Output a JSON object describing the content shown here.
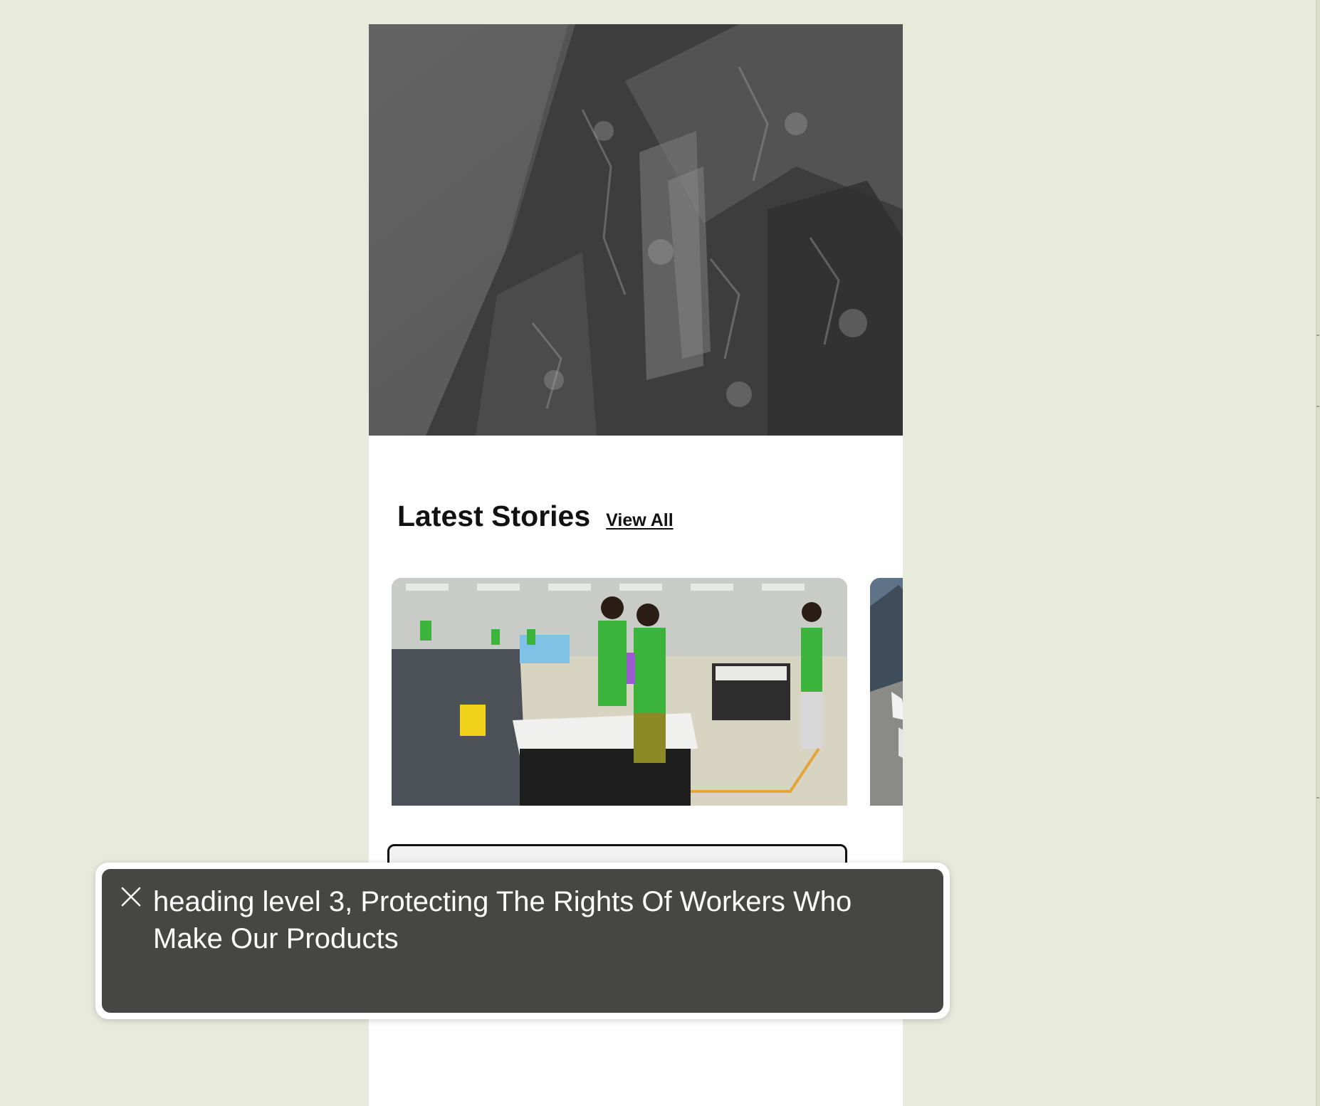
{
  "section": {
    "title": "Latest Stories",
    "view_all_label": "View All"
  },
  "cards": [
    {
      "title": "Protecting The Rights Of",
      "image_alt": "factory workers in green shirts at workstations"
    },
    {
      "image_alt": "mountain landscape"
    }
  ],
  "voiceover": {
    "caption": "heading level 3, Protecting The Rights Of Workers Who Make Our Products"
  },
  "colors": {
    "background": "#e8ebdc",
    "panel": "#464644",
    "text_dark": "#111111"
  },
  "icons": {
    "close": "close-icon"
  }
}
